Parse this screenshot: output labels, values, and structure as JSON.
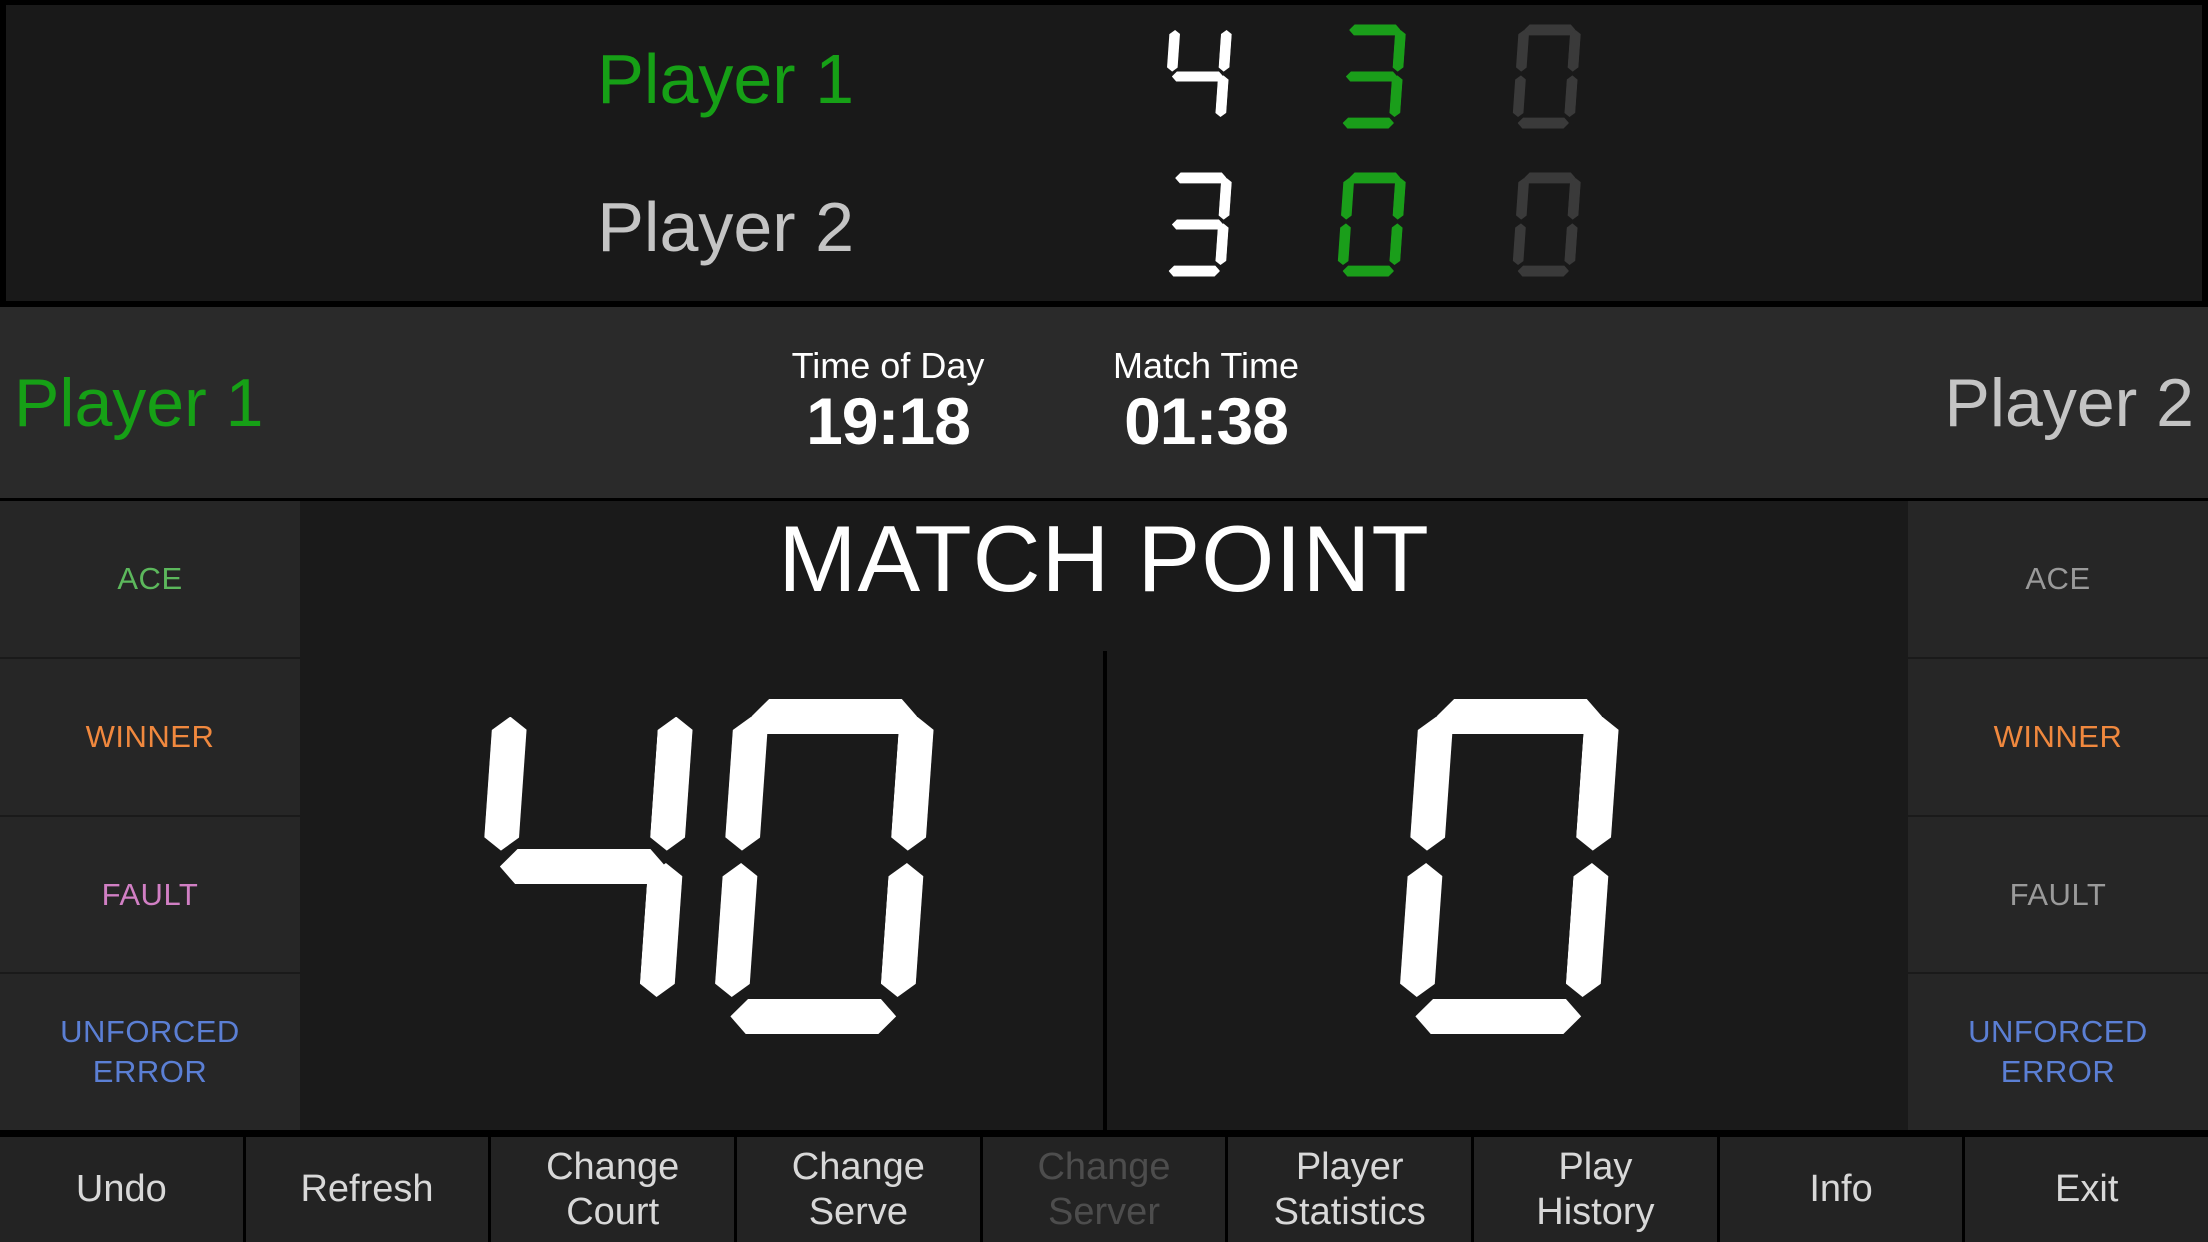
{
  "scoreboard": {
    "rows": [
      {
        "name": "Player 1",
        "serving": true,
        "name_color": "#16a016",
        "sets": [
          {
            "value": "4",
            "state": "white"
          },
          {
            "value": "3",
            "state": "green"
          },
          {
            "value": "0",
            "state": "dim"
          }
        ]
      },
      {
        "name": "Player 2",
        "serving": false,
        "name_color": "#c4c4c4",
        "sets": [
          {
            "value": "3",
            "state": "white"
          },
          {
            "value": "0",
            "state": "green"
          },
          {
            "value": "0",
            "state": "dim"
          }
        ]
      }
    ]
  },
  "midband": {
    "player1_label": "Player 1",
    "player2_label": "Player 2",
    "time_of_day_label": "Time of Day",
    "time_of_day_value": "19:18",
    "match_time_label": "Match Time",
    "match_time_value": "01:38"
  },
  "left_panel": [
    {
      "label": "ACE",
      "color": "#5cb85c",
      "enabled": true
    },
    {
      "label": "WINNER",
      "color": "#f0883e",
      "enabled": true
    },
    {
      "label": "FAULT",
      "color": "#d17fc4",
      "enabled": true
    },
    {
      "label": "UNFORCED\nERROR",
      "color": "#5b7fd4",
      "enabled": true
    }
  ],
  "right_panel": [
    {
      "label": "ACE",
      "color": "#9a9a9a",
      "enabled": false
    },
    {
      "label": "WINNER",
      "color": "#f0883e",
      "enabled": true
    },
    {
      "label": "FAULT",
      "color": "#9a9a9a",
      "enabled": false
    },
    {
      "label": "UNFORCED\nERROR",
      "color": "#5b7fd4",
      "enabled": true
    }
  ],
  "center": {
    "status_text": "MATCH POINT",
    "player1_game_score": "40",
    "player2_game_score": "0"
  },
  "bottom_bar": [
    {
      "label": "Undo",
      "enabled": true
    },
    {
      "label": "Refresh",
      "enabled": true
    },
    {
      "label": "Change\nCourt",
      "enabled": true
    },
    {
      "label": "Change\nServe",
      "enabled": true
    },
    {
      "label": "Change\nServer",
      "enabled": false
    },
    {
      "label": "Player\nStatistics",
      "enabled": true
    },
    {
      "label": "Play\nHistory",
      "enabled": true
    },
    {
      "label": "Info",
      "enabled": true
    },
    {
      "label": "Exit",
      "enabled": true
    }
  ],
  "colors": {
    "active_green": "#16a016",
    "digit_white": "#ffffff",
    "digit_green": "#1a9e1a",
    "digit_dim": "#3a3a3a",
    "inactive_gray": "#c4c4c4",
    "panel_bg": "#262626",
    "center_bg": "#1a1a1a",
    "midband_bg": "#2a2a2a"
  }
}
